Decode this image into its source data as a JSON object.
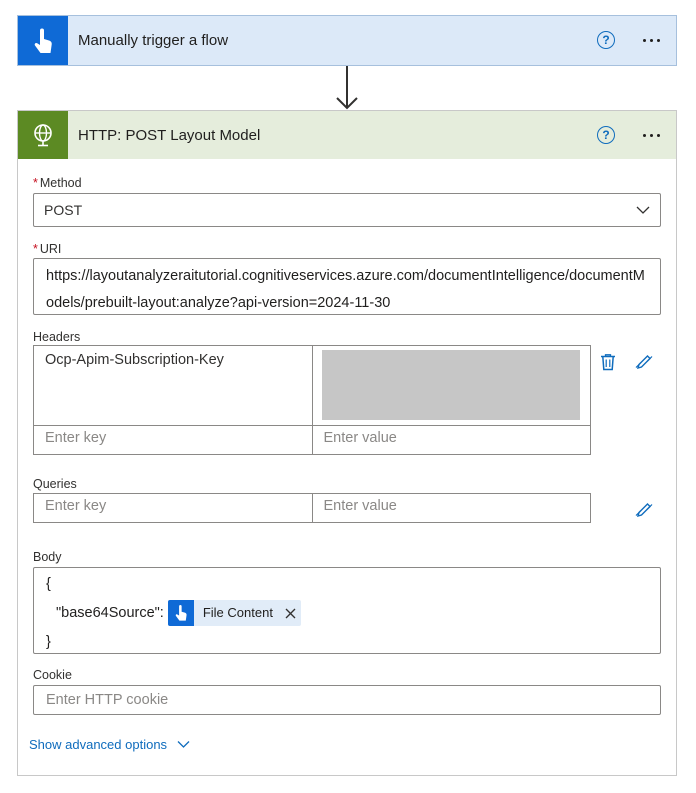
{
  "trigger": {
    "title": "Manually trigger a flow",
    "help_glyph": "?",
    "icon": "touch-hand-icon",
    "accent_color": "#0f6ad6",
    "header_bg": "#dce9f8"
  },
  "http": {
    "title": "HTTP: POST Layout Model",
    "help_glyph": "?",
    "icon": "globe-icon",
    "accent_color": "#5c8a23",
    "header_bg": "#e5eddc",
    "method": {
      "required_mark": "*",
      "label": "Method",
      "value": "POST"
    },
    "uri": {
      "required_mark": "*",
      "label": "URI",
      "value": "https://layoutanalyzeraitutorial.cognitiveservices.azure.com/documentIntelligence/documentModels/prebuilt-layout:analyze?api-version=2024-11-30"
    },
    "headers": {
      "label": "Headers",
      "rows": [
        {
          "key": "Ocp-Apim-Subscription-Key",
          "value": ""
        }
      ],
      "key_placeholder": "Enter key",
      "value_placeholder": "Enter value"
    },
    "queries": {
      "label": "Queries",
      "key_placeholder": "Enter key",
      "value_placeholder": "Enter value"
    },
    "body": {
      "label": "Body",
      "open_brace": "{",
      "key_text": "\"base64Source\":",
      "token_label": "File Content",
      "close_brace": "}"
    },
    "cookie": {
      "label": "Cookie",
      "placeholder": "Enter HTTP cookie"
    },
    "advanced_label": "Show advanced options"
  }
}
